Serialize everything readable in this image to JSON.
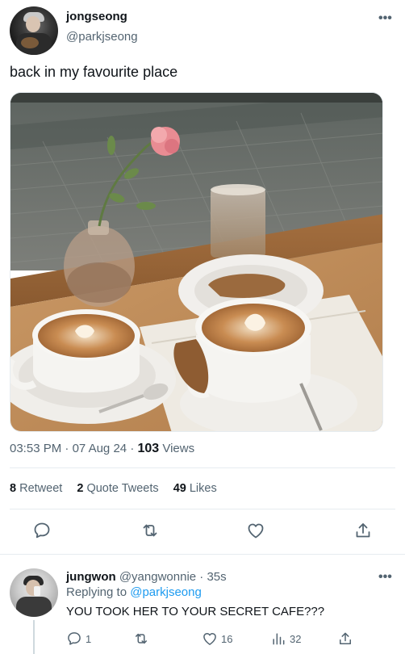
{
  "tweet": {
    "author_name": "jongseong",
    "author_handle": "@parkjseong",
    "text": "back in my favourite place",
    "time": "03:53 PM",
    "date": "07 Aug 24",
    "views_count": "103",
    "views_label": "Views",
    "retweet_count": "8",
    "retweet_label": "Retweet",
    "quote_count": "2",
    "quote_label": "Quote Tweets",
    "likes_count": "49",
    "likes_label": "Likes",
    "more_icon": "•••"
  },
  "reply": {
    "author_name": "jungwon",
    "author_handle": "@yangwonnie",
    "time": "35s",
    "replying_label": "Replying to",
    "replying_to": "@parkjseong",
    "text": "YOU TOOK HER TO YOUR SECRET CAFE???",
    "reply_count": "1",
    "retweet_count": "",
    "like_count": "16",
    "views_count": "32"
  },
  "icons": {
    "reply": "reply-icon",
    "retweet": "retweet-icon",
    "like": "heart-icon",
    "share": "share-icon",
    "views": "views-icon",
    "more": "more-icon"
  },
  "colors": {
    "text": "#0f1419",
    "secondary": "#536471",
    "accent": "#1d9bf0",
    "divider": "#e6ecf0"
  }
}
